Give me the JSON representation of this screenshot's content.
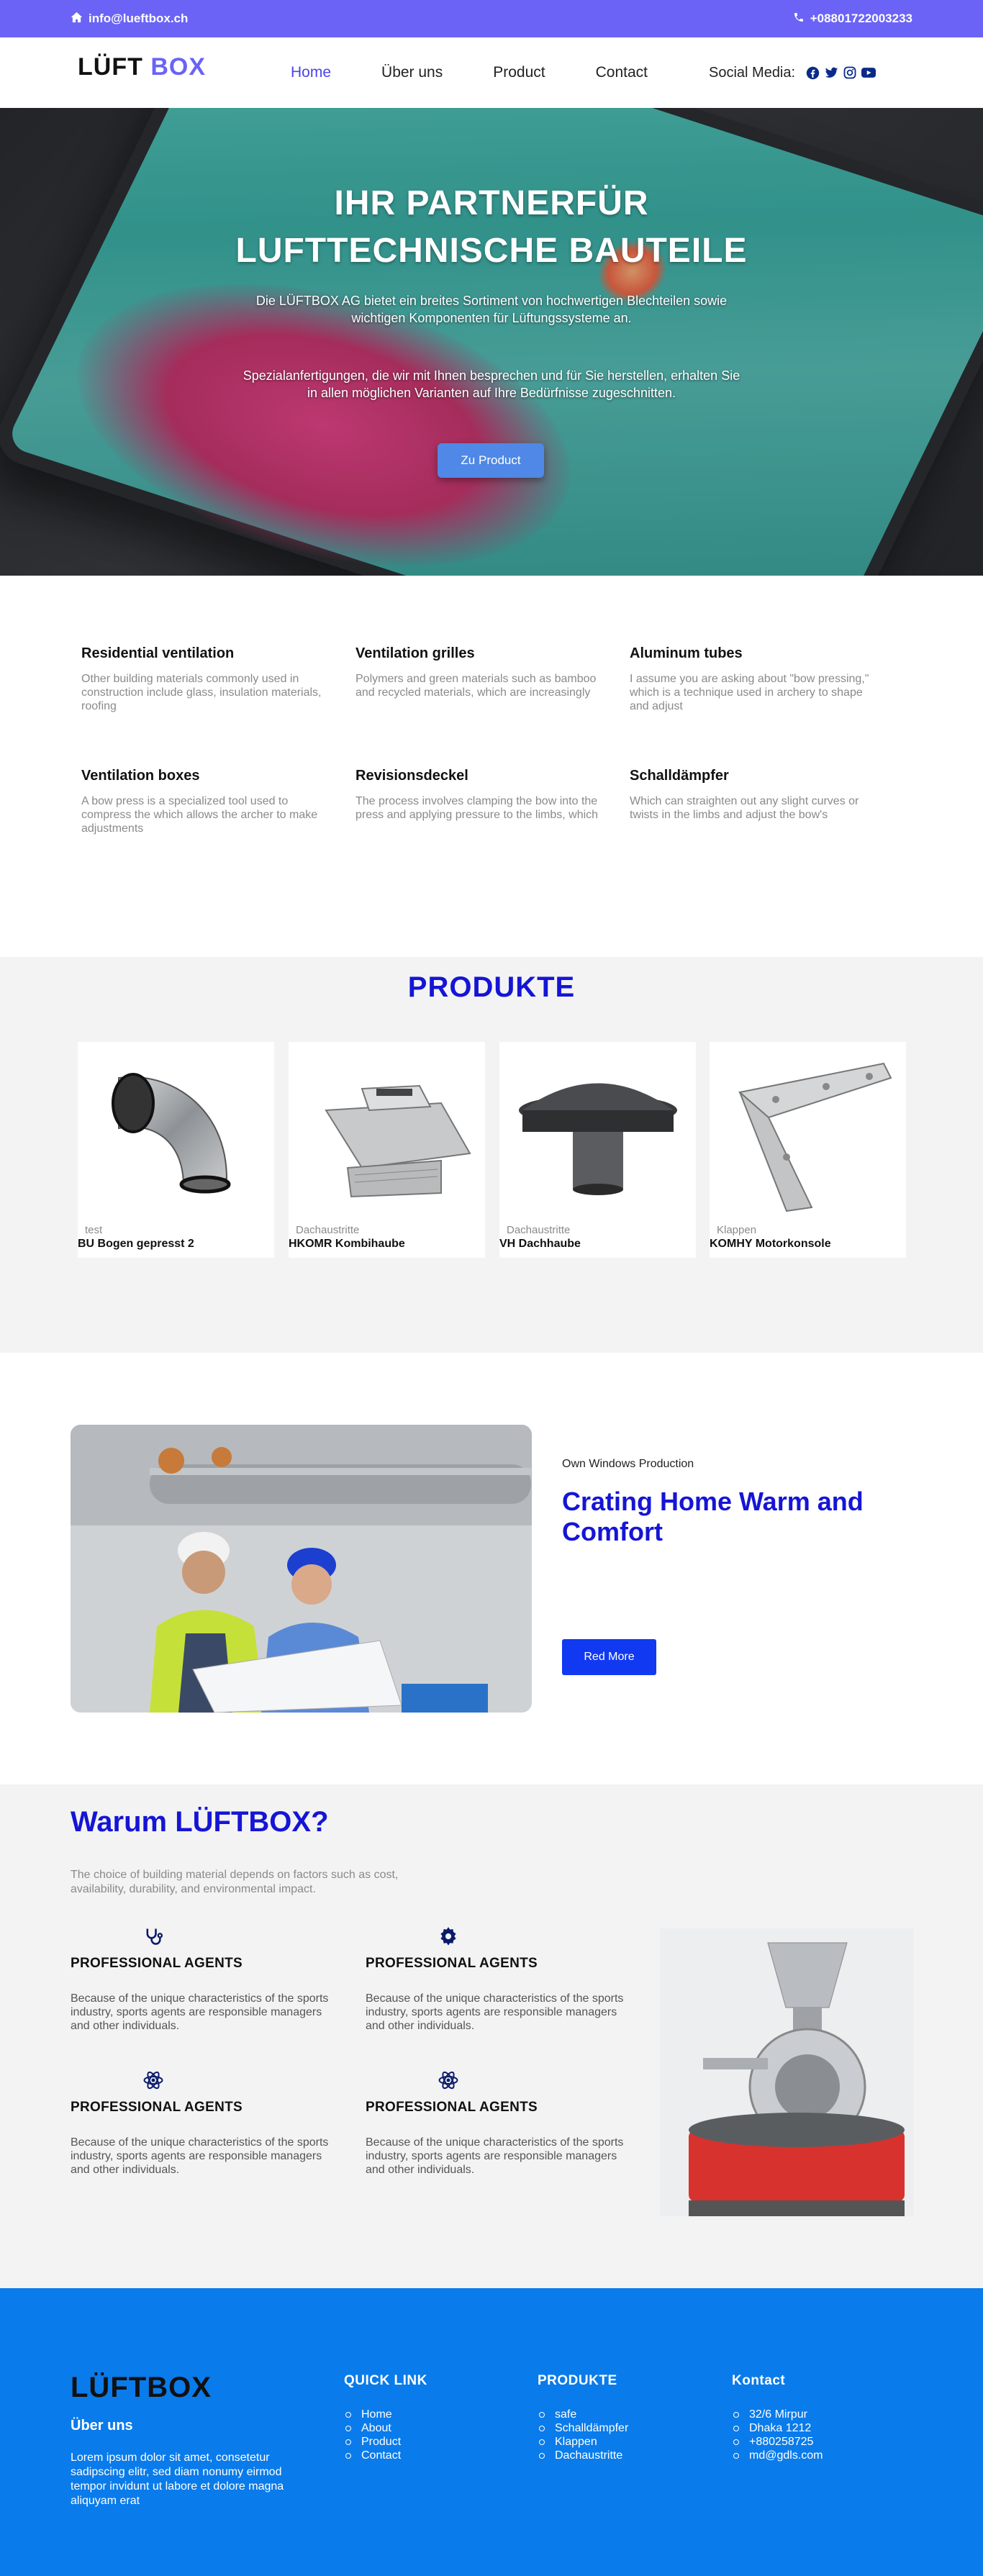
{
  "topbar": {
    "email": "info@lueftbox.ch",
    "phone": "+08801722003233"
  },
  "nav": {
    "logo_part1": "LÜFT",
    "logo_part2": "BOX",
    "menu": [
      "Home",
      "Über uns",
      "Product",
      "Contact"
    ],
    "active_index": 0,
    "social_label": "Social Media:",
    "social_icons": [
      "facebook-icon",
      "twitter-icon",
      "instagram-icon",
      "youtube-icon"
    ]
  },
  "hero": {
    "title_line1": "IHR PARTNERFÜR",
    "title_line2": "LUFTTECHNISCHE BAUTEILE",
    "paragraph1": "Die LÜFTBOX AG bietet ein breites Sortiment von hochwertigen Blechteilen sowie wichtigen Komponenten für Lüftungssysteme an.",
    "paragraph2": "Spezialanfertigungen, die wir mit Ihnen besprechen und für Sie herstellen, erhalten Sie in allen möglichen Varianten auf Ihre Bedürfnisse zugeschnitten.",
    "button": "Zu Product"
  },
  "features": [
    {
      "title": "Residential ventilation",
      "text": "Other building materials commonly used in construction include glass, insulation materials, roofing"
    },
    {
      "title": "Ventilation grilles",
      "text": "Polymers and green materials such as bamboo and recycled materials, which are increasingly"
    },
    {
      "title": "Aluminum tubes",
      "text": "I assume you are asking about \"bow pressing,\" which is a technique used in archery to shape and adjust"
    },
    {
      "title": "Ventilation boxes",
      "text": "A bow press is a specialized tool used to compress the which allows the archer to make adjustments"
    },
    {
      "title": "Revisionsdeckel",
      "text": "The process involves clamping the bow into the press and applying pressure to the limbs, which"
    },
    {
      "title": "Schalldämpfer",
      "text": "Which can straighten out any slight curves or twists in the limbs and adjust the bow's"
    }
  ],
  "products": {
    "heading": "PRODUKTE",
    "items": [
      {
        "category": "test",
        "name": "BU Bogen gepresst 2"
      },
      {
        "category": "Dachaustritte",
        "name": "HKOMR Kombihaube"
      },
      {
        "category": "Dachaustritte",
        "name": "VH Dachhaube"
      },
      {
        "category": "Klappen",
        "name": "KOMHY Motorkonsole"
      }
    ]
  },
  "about": {
    "kicker": "Own Windows Production",
    "heading": "Crating Home Warm and Comfort",
    "button": "Red More"
  },
  "why": {
    "heading": "Warum LÜFTBOX?",
    "intro": "The choice of building material depends on factors such as cost, availability, durability, and environmental impact.",
    "agents": [
      {
        "icon": "stethoscope-icon",
        "title": "PROFESSIONAL AGENTS",
        "text": "Because of the unique characteristics of the sports industry, sports agents are responsible managers and other individuals."
      },
      {
        "icon": "gear-icon",
        "title": "PROFESSIONAL AGENTS",
        "text": "Because of the unique characteristics of the sports industry, sports agents are responsible managers and other individuals."
      },
      {
        "icon": "atom-icon",
        "title": "PROFESSIONAL AGENTS",
        "text": "Because of the unique characteristics of the sports industry, sports agents are responsible managers and other individuals."
      },
      {
        "icon": "atom-icon",
        "title": "PROFESSIONAL AGENTS",
        "text": "Because of the unique characteristics of the sports industry, sports agents are responsible managers and other individuals."
      }
    ]
  },
  "footer": {
    "logo": "LÜFTBOX",
    "about_title": "Über uns",
    "about_text": "Lorem ipsum dolor sit amet, consetetur sadipscing elitr, sed diam nonumy eirmod tempor invidunt ut labore et dolore magna aliquyam erat",
    "quick_link": {
      "title": "QUICK LINK",
      "items": [
        "Home",
        "About",
        "Product",
        "Contact"
      ]
    },
    "produkte": {
      "title": "PRODUKTE",
      "items": [
        "safe",
        "Schalldämpfer",
        "Klappen",
        "Dachaustritte"
      ]
    },
    "kontakt": {
      "title": "Kontact",
      "items": [
        "32/6 Mirpur",
        "Dhaka 1212",
        "+880258725",
        "md@gdls.com"
      ]
    }
  },
  "colors": {
    "topbar": "#6a63f6",
    "accent_blue": "#1515d6",
    "button_blue": "#1139f2",
    "footer": "#0a7bea",
    "section_gray": "#f3f3f3"
  }
}
